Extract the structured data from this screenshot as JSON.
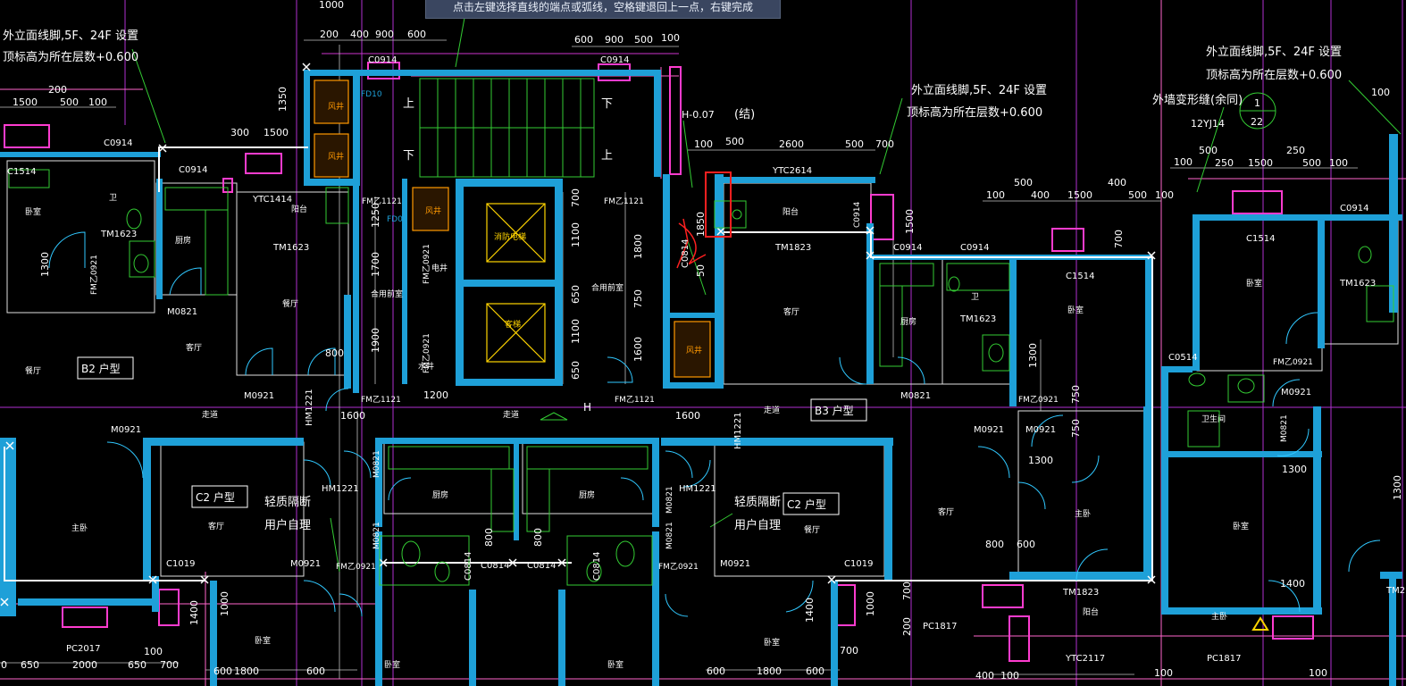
{
  "command_prompt": "点击左键选择直线的端点或弧线，空格键退回上一点，右键完成",
  "colors": {
    "background": "#000000",
    "wall": "#1ea0d8",
    "dimension_text": "#ffffff",
    "axis_magenta": "#cc33cc",
    "axis_pink": "#ff66cc",
    "fixtures": "#33cc33",
    "windows": "#ff3ccf",
    "door_arcs": "#30c8ff",
    "annotation_red": "#ff2020",
    "elevator_box": "#ffd400",
    "highlight_box": "#ff2020"
  },
  "annotations": {
    "note_left_1": "外立面线脚,5F、24F 设置",
    "note_left_2": "顶标高为所在层数+0.600",
    "note_mid_1": "外立面线脚,5F、24F 设置",
    "note_mid_2": "顶标高为所在层数+0.600",
    "note_right_1": "外立面线脚,5F、24F 设置",
    "note_right_2": "顶标高为所在层数+0.600",
    "note_expansion": "外墙变形缝(余同)",
    "note_12yj14": "12YJ14",
    "circle_top": "1",
    "circle_bottom": "22",
    "h_level": "H-0.07",
    "h_level_suffix": "(结)",
    "light_partition_1": "轻质隔断",
    "user_self_1": "用户自理",
    "light_partition_2": "轻质隔断",
    "user_self_2": "用户自理",
    "h_mark": "H"
  },
  "unit_labels": {
    "b2": "B2 户型",
    "b3": "B3 户型",
    "c2_left": "C2 户型",
    "c2_right": "C2 户型"
  },
  "element_codes": {
    "c0914_a": "C0914",
    "c0914_b": "C0914",
    "c0914_c": "C0914",
    "c0914_d": "C0914",
    "c0914_e": "C0914",
    "c0914_f": "C0914",
    "c1514_a": "C1514",
    "c1514_b": "C1514",
    "c1514_c": "C1514",
    "ytc1414": "YTC1414",
    "ytc2614": "YTC2614",
    "ytc2117": "YTC2117",
    "tm1623_a": "TM1623",
    "tm1623_b": "TM1623",
    "tm1623_c": "TM1623",
    "tm1623_d": "TM1623",
    "tm1823_a": "TM1823",
    "tm1823_b": "TM1823",
    "m0821_a": "M0821",
    "m0821_b": "M0821",
    "m0921_a": "M0921",
    "m0921_b": "M0921",
    "m0921_c": "M0921",
    "m0921_d": "M0921",
    "m0921_e": "M0921",
    "m0921_f": "M0921",
    "m0921_g": "M0921",
    "hm1221_a": "HM1221",
    "hm1221_b": "HM1221",
    "hm1221_c": "HM1221",
    "hm1221_d": "HM1221",
    "fm1121_a": "FM乙1121",
    "fm1121_b": "FM乙1121",
    "fm1121_c": "FM乙1121",
    "fm1121_d": "FM乙1121",
    "fm0921_a": "FM乙0921",
    "fm0921_b": "FM乙0921",
    "fm0921_c": "FM乙0921",
    "fm0921_d": "FM乙0921",
    "c1019_a": "C1019",
    "c1019_b": "C1019",
    "c0814_a": "C0814",
    "c0814_b": "C0814",
    "c0814_c": "C0814",
    "c0814_d": "C0814",
    "c0814_e": "C0814",
    "pc2017": "PC2017",
    "pc1817_a": "PC1817",
    "pc1817_b": "PC1817",
    "c0514": "C0514",
    "fd10": "FD10",
    "fd08": "FD08",
    "dn_up": "上",
    "dn_down": "下",
    "tm2": "TM2"
  },
  "rooms": {
    "bedroom_b2": "卧室",
    "bath_b2": "卫",
    "kitchen_b2": "厨房",
    "living_b2": "客厅",
    "dining_b2": "餐厅",
    "balcony_b2": "阳台",
    "corridor_left": "走道",
    "corridor_mid": "走道",
    "corridor_right": "走道",
    "elev_1": "消防电梯",
    "elev_2": "客梯",
    "front_room": "合用前室",
    "balcony_b3": "阳台",
    "living_b3": "客厅",
    "kitchen_b3": "厨房",
    "bath_b3": "卫",
    "bedroom_b3": "卧室",
    "master_b3": "主卧",
    "bedroom_r": "卧室",
    "bath_r": "卫生间",
    "bedroom_r2": "卧室",
    "living_c2_left": "客厅",
    "kitchen_c2_l": "厨房",
    "kitchen_c2_r": "厨房",
    "master_left": "主卧",
    "living_c2_r": "客厅",
    "dining_c2_r": "餐厅",
    "bedroom_bottom_l": "卧室",
    "bedroom_bottom_m1": "卧室",
    "bedroom_bottom_m2": "卧室",
    "bedroom_bottom_r": "卧室",
    "balcony_bottom": "阳台",
    "master_bottom_r": "主卧",
    "pipe_well": "电井",
    "water_well": "水井",
    "wind_well": "风井"
  },
  "dimensions": {
    "d1000_top": "1000",
    "d200_a": "200",
    "d400_a": "400",
    "d900_a": "900",
    "d600_a": "600",
    "d600_b": "600",
    "d900_b": "900",
    "d500_b": "500",
    "d100_b": "100",
    "d1500_a": "1500",
    "d200_b": "200",
    "d500_c": "500",
    "d100_c": "100",
    "d1350": "1350",
    "d300": "300",
    "d1500_b": "1500",
    "d100_d": "100",
    "d500_d": "500",
    "d2600": "2600",
    "d500_e": "500",
    "d700_e": "700",
    "d500_f": "500",
    "d100_f": "100",
    "d400_f": "400",
    "d1500_f": "1500",
    "d400_g": "400",
    "d500_g": "500",
    "d100_g": "100",
    "d100_h": "100",
    "d500_h": "500",
    "d250_h": "250",
    "d1500_h": "1500",
    "d250_i": "250",
    "d500_i": "500",
    "d100_i": "100",
    "d100_r": "100",
    "d700_v": "700",
    "d1100_v1": "1100",
    "d650_v": "650",
    "d1100_v2": "1100",
    "d650_v2": "650",
    "d1800_v": "1800",
    "d750_v": "750",
    "d1600_v": "1600",
    "d1250_v": "1250",
    "d1700_v": "1700",
    "d1900_v": "1900",
    "d1850_v": "1850",
    "d50_v": "50",
    "d1300_v": "1300",
    "d1500_v2": "1500",
    "d800_a": "800",
    "d1200": "1200",
    "d1600_a": "1600",
    "d1600_b": "1600",
    "d750_v3": "750",
    "d750_v4": "750",
    "d1300_v2": "1300",
    "d1300_h": "1300",
    "d800_b": "800",
    "d600_r": "600",
    "d1300_h2": "1300",
    "d800_c": "800",
    "d800_d": "800",
    "d1400_h": "1400",
    "d1400_v": "1400",
    "d1000_v": "1000",
    "d1400_v2": "1400",
    "d1000_v2": "1000",
    "d700_v2": "700",
    "d200_v": "200",
    "d700_v3": "700",
    "d1800_b": "1800",
    "d600_c": "600",
    "d600_d": "600",
    "d100_j": "100",
    "d1800_c": "1800",
    "d600_e": "600",
    "d400_k": "400",
    "d100_k": "100",
    "d1300_l": "1300",
    "d0_a": "0",
    "d650_a": "650",
    "d2000": "2000",
    "d650_b": "650",
    "d700_b": "700",
    "d100_m": "100"
  }
}
